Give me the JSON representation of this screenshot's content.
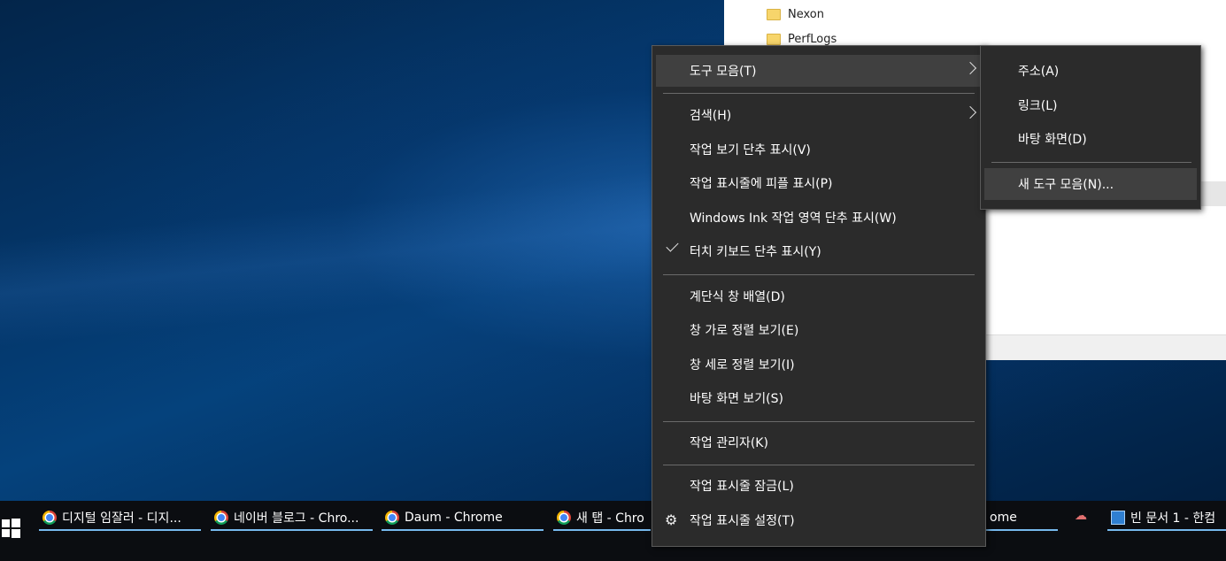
{
  "explorer": {
    "folders": [
      "Nexon",
      "PerfLogs"
    ]
  },
  "taskbar": {
    "items": [
      {
        "label": "디지털 임잘러 - 디지...",
        "icon": "chrome-icon"
      },
      {
        "label": "네이버 블로그 - Chro...",
        "icon": "chrome-icon"
      },
      {
        "label": "Daum - Chrome",
        "icon": "chrome-icon"
      },
      {
        "label": "새 탭 - Chro",
        "icon": "chrome-icon"
      },
      {
        "label": "ome",
        "icon": "chrome-icon"
      },
      {
        "label": "빈 문서 1 - 한컴",
        "icon": "hwp-icon"
      }
    ]
  },
  "context_menu": {
    "items": [
      {
        "label": "도구 모음(T)",
        "submenu": true,
        "highlighted": true
      },
      {
        "label": "검색(H)",
        "submenu": true
      },
      {
        "label": "작업 보기 단추 표시(V)"
      },
      {
        "label": "작업 표시줄에 피플 표시(P)"
      },
      {
        "label": "Windows Ink 작업 영역 단추 표시(W)"
      },
      {
        "label": "터치 키보드 단추 표시(Y)",
        "checked": true
      },
      {
        "label": "계단식 창 배열(D)"
      },
      {
        "label": "창 가로 정렬 보기(E)"
      },
      {
        "label": "창 세로 정렬 보기(I)"
      },
      {
        "label": "바탕 화면 보기(S)"
      },
      {
        "label": "작업 관리자(K)"
      },
      {
        "label": "작업 표시줄 잠금(L)"
      },
      {
        "label": "작업 표시줄 설정(T)",
        "icon": "gear-icon"
      }
    ]
  },
  "toolbar_submenu": {
    "items": [
      {
        "label": "주소(A)"
      },
      {
        "label": "링크(L)"
      },
      {
        "label": "바탕 화면(D)"
      },
      {
        "label": "새 도구 모음(N)...",
        "highlighted": true
      }
    ]
  },
  "colors": {
    "menu_bg": "#2b2b2b",
    "menu_highlight": "#404040",
    "taskbar_bg": "#0b0d11",
    "taskbar_underline": "#76b9ed"
  }
}
